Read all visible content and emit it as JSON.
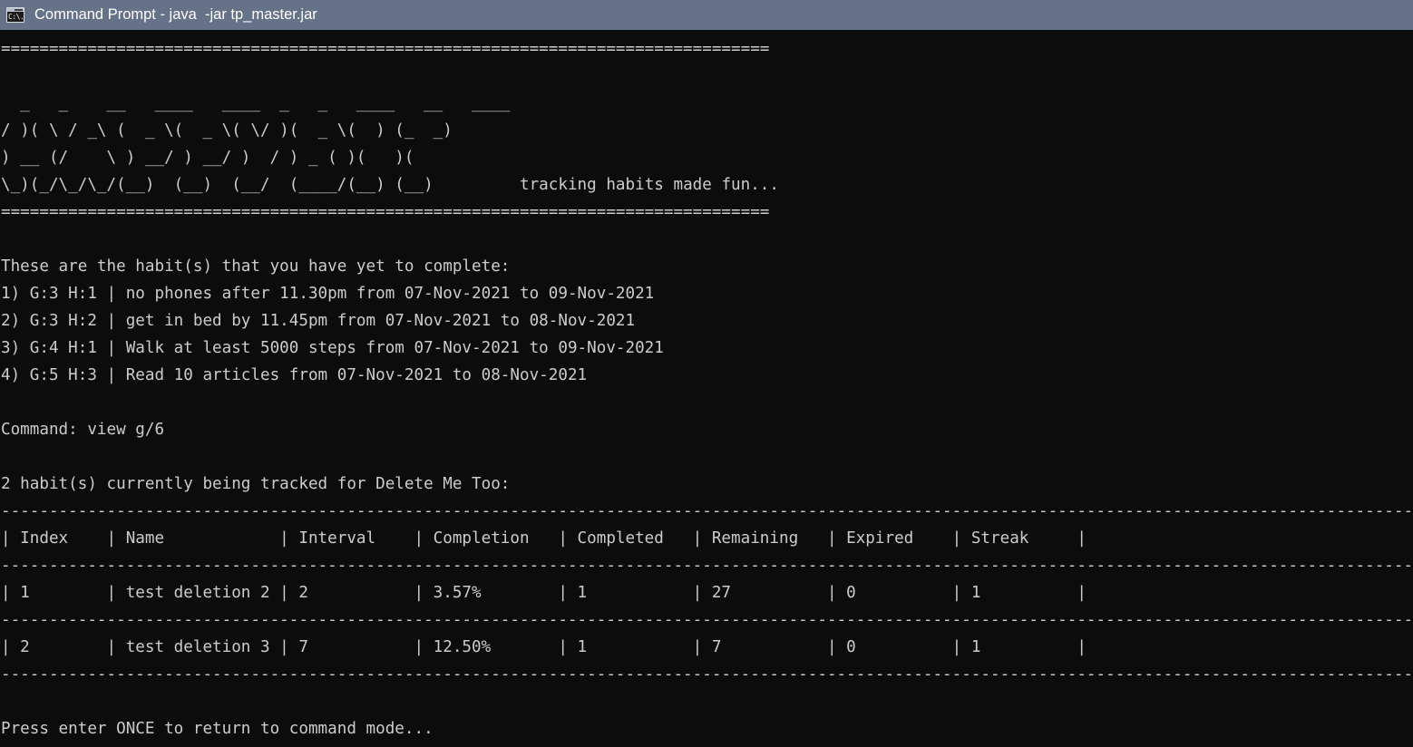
{
  "window": {
    "title": "Command Prompt - java  -jar tp_master.jar",
    "icon_name": "command-prompt-icon",
    "icon_glyph": "C:\\.",
    "titlebar_color": "#657287",
    "titlebar_text_color": "#ffffff"
  },
  "terminal": {
    "background_color": "#0c0c0c",
    "text_color": "#cccccc",
    "banner": {
      "rule_top": "================================================================================",
      "rule_bottom": "================================================================================",
      "ascii_art": [
        "  _   _    __   ____   ____  _   _   ____   __   ____  ",
        "/ )( \\ / _\\ (  _ \\(  _ \\( \\/ )(  _ \\(  ) (_  _) ",
        ") __ (/    \\ ) __/ ) __/ )  / ) _ ( )(   )(   ",
        "\\_)(_/\\_/\\_/(__)  (__)  (__/  (____/(__) (__)  "
      ],
      "tagline": "tracking habits made fun..."
    },
    "pending_section": {
      "heading": "These are the habit(s) that you have yet to complete:",
      "items": [
        "1) G:3 H:1 | no phones after 11.30pm from 07-Nov-2021 to 09-Nov-2021",
        "2) G:3 H:2 | get in bed by 11.45pm from 07-Nov-2021 to 08-Nov-2021",
        "3) G:4 H:1 | Walk at least 5000 steps from 07-Nov-2021 to 09-Nov-2021",
        "4) G:5 H:3 | Read 10 articles from 07-Nov-2021 to 08-Nov-2021"
      ]
    },
    "command_prompt": {
      "label": "Command:",
      "entered_command": "view g/6",
      "full_line": "Command: view g/6"
    },
    "tracking_section": {
      "heading": "2 habit(s) currently being tracked for Delete Me Too:",
      "count": 2,
      "goal_name": "Delete Me Too",
      "table": {
        "divider": "---------------------------------------------------------------------------------------------------------------------------------------------------",
        "headers": [
          "Index",
          "Name",
          "Interval",
          "Completion",
          "Completed",
          "Remaining",
          "Expired",
          "Streak"
        ],
        "header_line": "| Index    | Name            | Interval    | Completion   | Completed   | Remaining   | Expired    | Streak     |",
        "rows": [
          {
            "cells": [
              "1",
              "test deletion 2",
              "2",
              "3.57%",
              "1",
              "27",
              "0",
              "1"
            ],
            "line": "| 1        | test deletion 2 | 2           | 3.57%        | 1           | 27          | 0          | 1          |"
          },
          {
            "cells": [
              "2",
              "test deletion 3",
              "7",
              "12.50%",
              "1",
              "7",
              "0",
              "1"
            ],
            "line": "| 2        | test deletion 3 | 7           | 12.50%       | 1           | 7           | 0          | 1          |"
          }
        ]
      }
    },
    "footer": {
      "message": "Press enter ONCE to return to command mode..."
    }
  }
}
